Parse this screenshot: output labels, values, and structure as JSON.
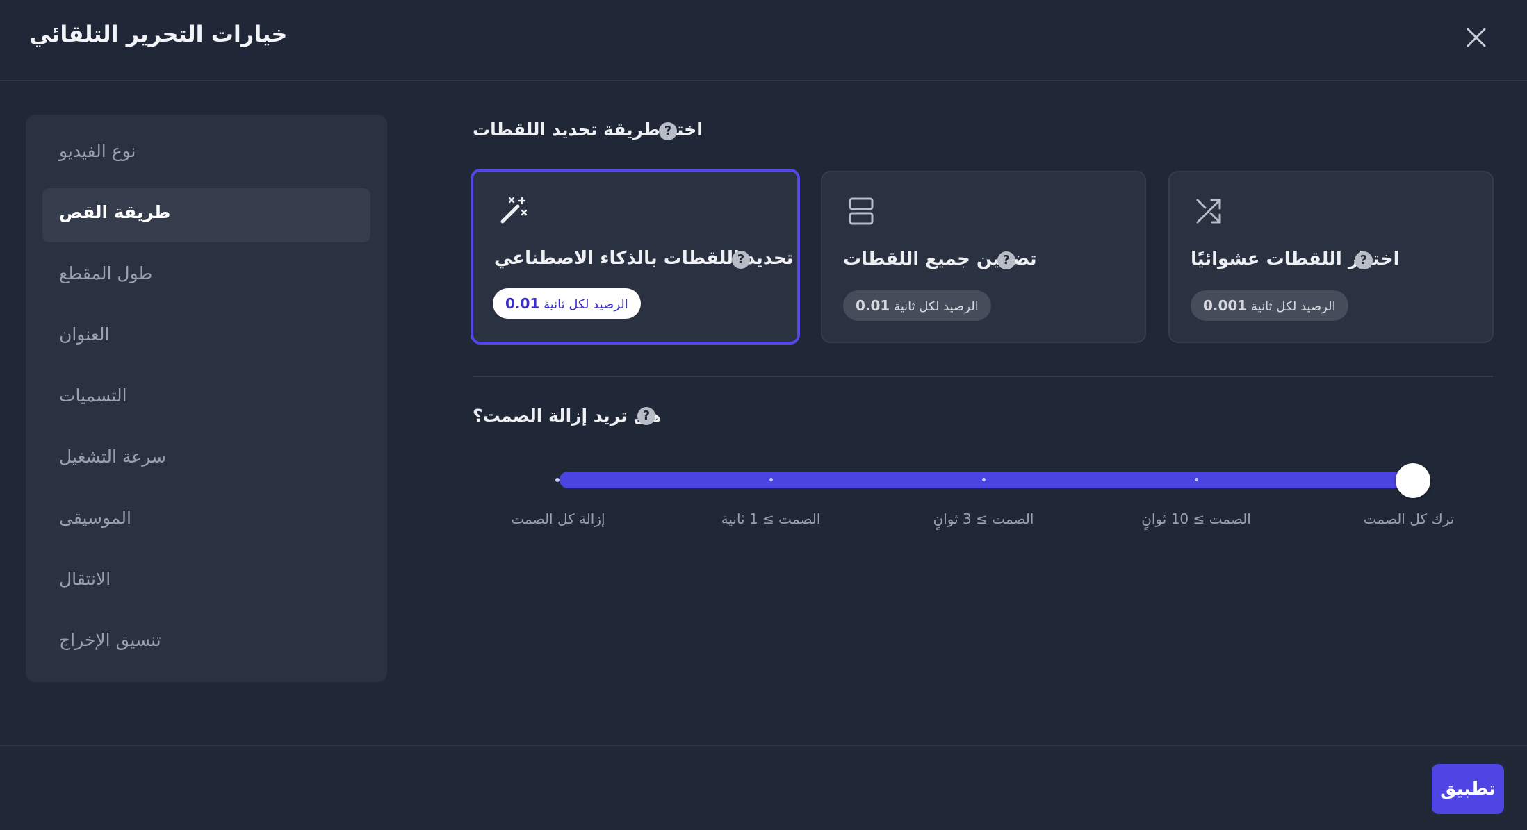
{
  "dialog": {
    "title": "خيارات التحرير التلقائي"
  },
  "sidebar": {
    "items": [
      {
        "label": "نوع الفيديو",
        "active": false
      },
      {
        "label": "طريقة القص",
        "active": true
      },
      {
        "label": "طول المقطع",
        "active": false
      },
      {
        "label": "العنوان",
        "active": false
      },
      {
        "label": "التسميات",
        "active": false
      },
      {
        "label": "سرعة التشغيل",
        "active": false
      },
      {
        "label": "الموسيقى",
        "active": false
      },
      {
        "label": "الانتقال",
        "active": false
      },
      {
        "label": "تنسيق الإخراج",
        "active": false
      }
    ]
  },
  "clip_method": {
    "title": "اختر طريقة تحديد اللقطات",
    "options": [
      {
        "label": "تحديد اللقطات بالذكاء الاصطناعي",
        "badge_text": "الرصيد لكل ثانية",
        "badge_value": "0.01",
        "icon": "magic-wand-icon",
        "selected": true
      },
      {
        "label": "تضمين جميع اللقطات",
        "badge_text": "الرصيد لكل ثانية",
        "badge_value": "0.01",
        "icon": "rows-layout-icon",
        "selected": false
      },
      {
        "label": "اختيار اللقطات عشوائيًا",
        "badge_text": "الرصيد لكل ثانية",
        "badge_value": "0.001",
        "icon": "shuffle-icon",
        "selected": false
      }
    ]
  },
  "silence": {
    "title": "هل تريد إزالة الصمت؟",
    "ticks": [
      "إزالة كل الصمت",
      "الصمت ≥ 1 ثانية",
      "الصمت ≥ 3 ثوانٍ",
      "الصمت ≥ 10 ثوانٍ",
      "ترك كل الصمت"
    ],
    "selected_index": 4
  },
  "footer": {
    "apply_label": "تطبيق"
  },
  "colors": {
    "accent": "#4f45e4",
    "background": "#202837",
    "panel": "#2a3140"
  }
}
